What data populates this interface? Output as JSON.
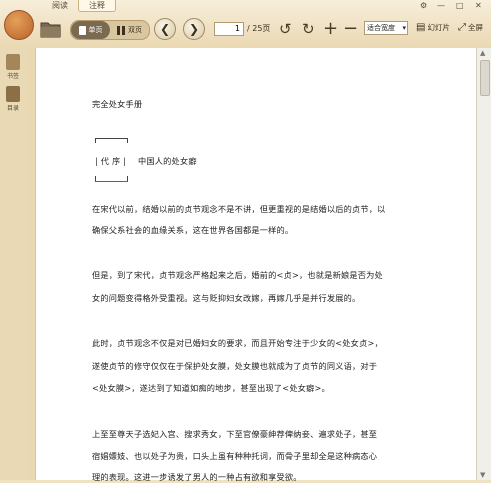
{
  "tabs": [
    {
      "label": "阅读"
    },
    {
      "label": "注释"
    }
  ],
  "toolbar": {
    "single_page_label": "单页",
    "double_page_label": "双页",
    "page_current": "1",
    "page_total": "/ 25页",
    "zoom_value": "适合宽度",
    "slideshow_label": "幻灯片",
    "fullscreen_label": "全屏"
  },
  "window_controls": {
    "settings": "⚙",
    "minimize": "—",
    "maximize": "□",
    "close": "✕"
  },
  "sidebar": {
    "items": [
      {
        "label": "书签"
      },
      {
        "label": "目录"
      }
    ]
  },
  "document": {
    "title": "完全处女手册",
    "preface_label": "代 序",
    "preface_subtitle": "中国人的处女癖",
    "paragraphs": [
      [
        "在宋代以前，结婚以前的贞节观念不是不讲，但更重视的是结婚以后的贞节，以",
        "确保父系社会的血缘关系，这在世界各国都是一样的。"
      ],
      [
        "但是，到了宋代，贞节观念严格起来之后，婚前的<贞>，也就是新娘是否为处",
        "女的问题变得格外受重视。这与贬抑妇女改嫁，再嫁几乎是并行发展的。"
      ],
      [
        "此时，贞节观念不仅是对已婚妇女的要求，而且开始专注于少女的<处女贞>，",
        "遂使贞节的修守仅仅在于保护处女膜，处女膜也就成为了贞节的同义语，对于",
        "<处女膜>，遂达到了知道如痴的地步，甚至出现了<处女癖>。"
      ],
      [
        "上至至尊天子选妃入宫、搜求秀女，下至官僚豪绅荐俾纳妾、遍求处子，甚至",
        "宿娼嫖妓、也以处子为贵，口头上虽有种种托词，而骨子里却全是这种病态心",
        "理的表现。这进一步诱发了男人的一种占有欲和享受欲。"
      ]
    ]
  }
}
